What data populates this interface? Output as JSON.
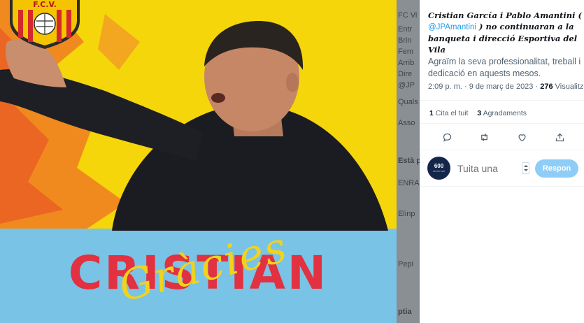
{
  "media": {
    "club_badge_text": "F.C.V.",
    "headline": "CRISTIAN",
    "script_text": "Gràcies",
    "colors": {
      "yellow": "#f5d60a",
      "orange": "#f0801c",
      "sky": "#79c3e6",
      "red": "#e23140"
    }
  },
  "background_strip": {
    "fragments": [
      "FC Vi",
      "Entr",
      "Brin",
      "Fem",
      "Arrib",
      "Dire",
      "@JP",
      "Quals",
      "Asso",
      "Està p",
      "ENRA",
      "Elinp",
      "Pepi",
      "ptia"
    ]
  },
  "tweet": {
    "text_part1": "Cristian Garcίa i Pablo Amantini (",
    "mention": "@JPAmantini",
    "text_part2": ") no continuaran a la banqueta i direcció Esportiva del Vila",
    "body": "Agraïm la seva professionalitat, treball i dedicació en aquests mesos.",
    "time": "2:09 p. m. · 9 de març de 2023 ·",
    "views_count": "276",
    "views_label": "Visualitzacions"
  },
  "stats": {
    "quotes_count": "1",
    "quotes_label": "Cita el tuit",
    "likes_count": "3",
    "likes_label": "Agradaments"
  },
  "actions": {
    "icons": [
      "reply-icon",
      "retweet-icon",
      "like-icon",
      "share-icon"
    ]
  },
  "reply": {
    "avatar_text": "600",
    "avatar_sub": "aniversari",
    "placeholder": "Tuita una",
    "button_label": "Respon"
  }
}
